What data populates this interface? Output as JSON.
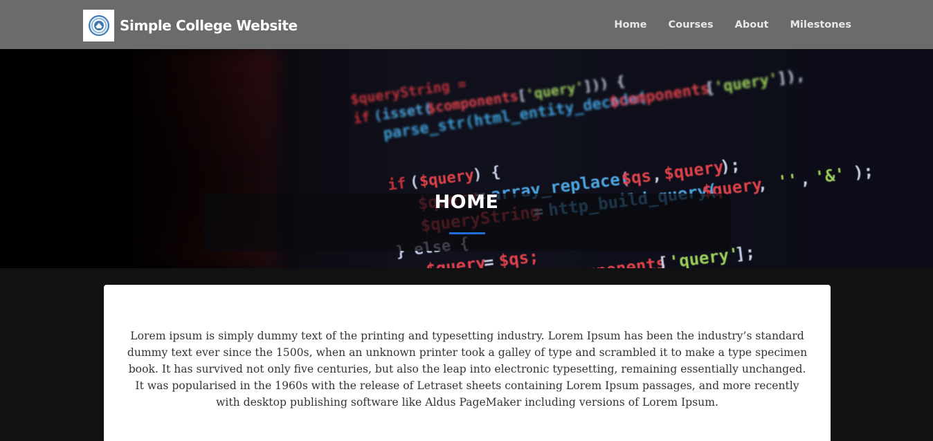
{
  "header": {
    "brand_title": "Simple College Website",
    "logo_icon": "college-seal-icon",
    "nav": [
      {
        "label": "Home"
      },
      {
        "label": "Courses"
      },
      {
        "label": "About"
      },
      {
        "label": "Milestones"
      }
    ]
  },
  "hero": {
    "title": "HOME",
    "underline_color": "#1f6ed8",
    "background": "code-screenshot-image"
  },
  "main": {
    "paragraph": "Lorem ipsum is simply dummy text of the printing and typesetting industry. Lorem Ipsum has been the industry’s standard dummy text ever since the 1500s, when an unknown printer took a galley of type and scrambled it to make a type specimen book. It has survived not only five centuries, but also the leap into electronic typesetting, remaining essentially unchanged. It was popularised in the 1960s with the release of Letraset sheets containing Lorem Ipsum passages, and more recently with desktop publishing software like Aldus PageMaker including versions of Lorem Ipsum."
  },
  "colors": {
    "navbar": "#6b6b6b",
    "page_background": "#111111",
    "card": "#ffffff"
  }
}
